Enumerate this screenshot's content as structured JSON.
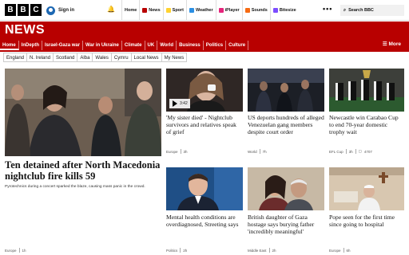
{
  "masthead": {
    "logo": [
      "B",
      "B",
      "C"
    ],
    "signin": "Sign in",
    "nav": [
      {
        "label": "Home",
        "color": "#141414"
      },
      {
        "label": "News",
        "color": "#b80000"
      },
      {
        "label": "Sport",
        "color": "#ffd230"
      },
      {
        "label": "Weather",
        "color": "#2b8fe3"
      },
      {
        "label": "iPlayer",
        "color": "#e5247b"
      },
      {
        "label": "Sounds",
        "color": "#f66a12"
      },
      {
        "label": "Bitesize",
        "color": "#7c4dff"
      }
    ],
    "more": "•••",
    "search": "Search BBC"
  },
  "newsbar": {
    "title": "NEWS",
    "sections": [
      "Home",
      "InDepth",
      "Israel-Gaza war",
      "War in Ukraine",
      "Climate",
      "UK",
      "World",
      "Business",
      "Politics",
      "Culture"
    ],
    "more": "☰ More"
  },
  "subnav": [
    "England",
    "N. Ireland",
    "Scotland",
    "Alba",
    "Wales",
    "Cymru",
    "Local News",
    "My News"
  ],
  "lead": {
    "headline": "Ten detained after North Macedonia nightclub fire kills 59",
    "summary": "Pyrotechnics during a concert sparked the blaze, causing mass panic in the crowd.",
    "section": "Europe",
    "age": "1h"
  },
  "cards": [
    {
      "headline": "'My sister died' - Nightclub survivors and relatives speak of grief",
      "section": "Europe",
      "age": "3h",
      "video": "3:42"
    },
    {
      "headline": "US deports hundreds of alleged Venezuelan gang members despite court order",
      "section": "World",
      "age": "7h"
    },
    {
      "headline": "Newcastle win Carabao Cup to end 70-year domestic trophy wait",
      "section": "EFL Cup",
      "age": "3h",
      "comments": "4707"
    },
    {
      "headline": "Mental health conditions are overdiagnosed, Streeting says",
      "section": "Politics",
      "age": "2h"
    },
    {
      "headline": "British daughter of Gaza hostage says burying father 'incredibly meaningful'",
      "section": "Middle East",
      "age": "2h"
    },
    {
      "headline": "Pope seen for the first time since going to hospital",
      "section": "Europe",
      "age": "6h"
    }
  ]
}
